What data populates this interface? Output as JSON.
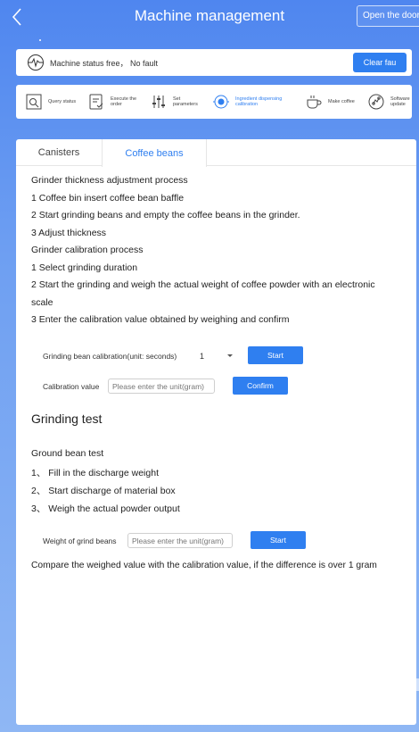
{
  "header": {
    "title": "Machine management",
    "open_door_label": "Open the door"
  },
  "status": {
    "text": "Machine status  free， No fault",
    "clear_button": "Clear fau"
  },
  "nav": {
    "items": [
      {
        "label": "Query status",
        "icon": "query-status-icon"
      },
      {
        "label": "Execute the order",
        "icon": "execute-order-icon"
      },
      {
        "label": "Set parameters",
        "icon": "set-parameters-icon"
      },
      {
        "label": "Ingredient dispensing calibration",
        "icon": "calibration-icon"
      },
      {
        "label": "Make coffee",
        "icon": "coffee-cup-icon"
      },
      {
        "label": "Software update",
        "icon": "software-update-icon"
      }
    ],
    "active_index": 3
  },
  "panel": {
    "tabs": [
      "Canisters",
      "Coffee beans"
    ],
    "active_tab": 1,
    "lines": [
      "Grinder thickness adjustment process",
      "1 Coffee bin insert coffee bean baffle",
      "2 Start grinding beans and empty the coffee beans in the grinder.",
      "3 Adjust thickness",
      "Grinder calibration process",
      "1 Select grinding duration",
      "2 Start the grinding and weigh the actual weight of coffee powder with an electronic",
      "scale",
      "3 Enter the calibration value obtained by weighing and confirm"
    ],
    "calibration_row": {
      "label": "Grinding bean calibration(unit: seconds)",
      "selected_value": "1",
      "start_button": "Start"
    },
    "calibration_value_row": {
      "label": "Calibration value",
      "placeholder": "Please enter the unit(gram)",
      "confirm_button": "Confirm"
    },
    "grinding_test": {
      "title": "Grinding test",
      "lines": [
        "Ground bean test",
        "1、 Fill in the discharge weight",
        "2、 Start discharge of material box",
        "3、 Weigh the actual powder output"
      ],
      "weight_label": "Weight of grind beans",
      "weight_placeholder": "Please enter the unit(gram)",
      "start_button": "Start",
      "note": "Compare the weighed value with the calibration value, if the difference is over 1 gram"
    }
  },
  "colors": {
    "accent": "#2f7ff0",
    "header_gradient_top": "#4f86ef",
    "header_gradient_bottom": "#8fb7f4"
  }
}
